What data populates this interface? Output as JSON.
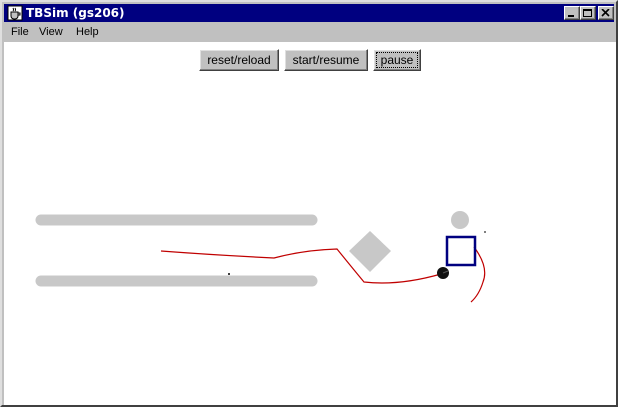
{
  "window": {
    "title": "TBSim (gs206)",
    "icon": "java-cup-icon",
    "controls": {
      "minimize_icon": "minimize-icon",
      "maximize_icon": "maximize-icon",
      "close_icon": "close-icon"
    }
  },
  "menubar": {
    "items": [
      {
        "label": "File"
      },
      {
        "label": "View"
      },
      {
        "label": "Help"
      }
    ]
  },
  "toolbar": {
    "reset_label": "reset/reload",
    "start_label": "start/resume",
    "pause_label": "pause"
  },
  "simulation": {
    "colors": {
      "wall": "#c8c8c8",
      "obstacle": "#c8c8c8",
      "trail": "#c00000",
      "robot": "#111111",
      "target": "#000080",
      "background": "#ffffff"
    }
  }
}
